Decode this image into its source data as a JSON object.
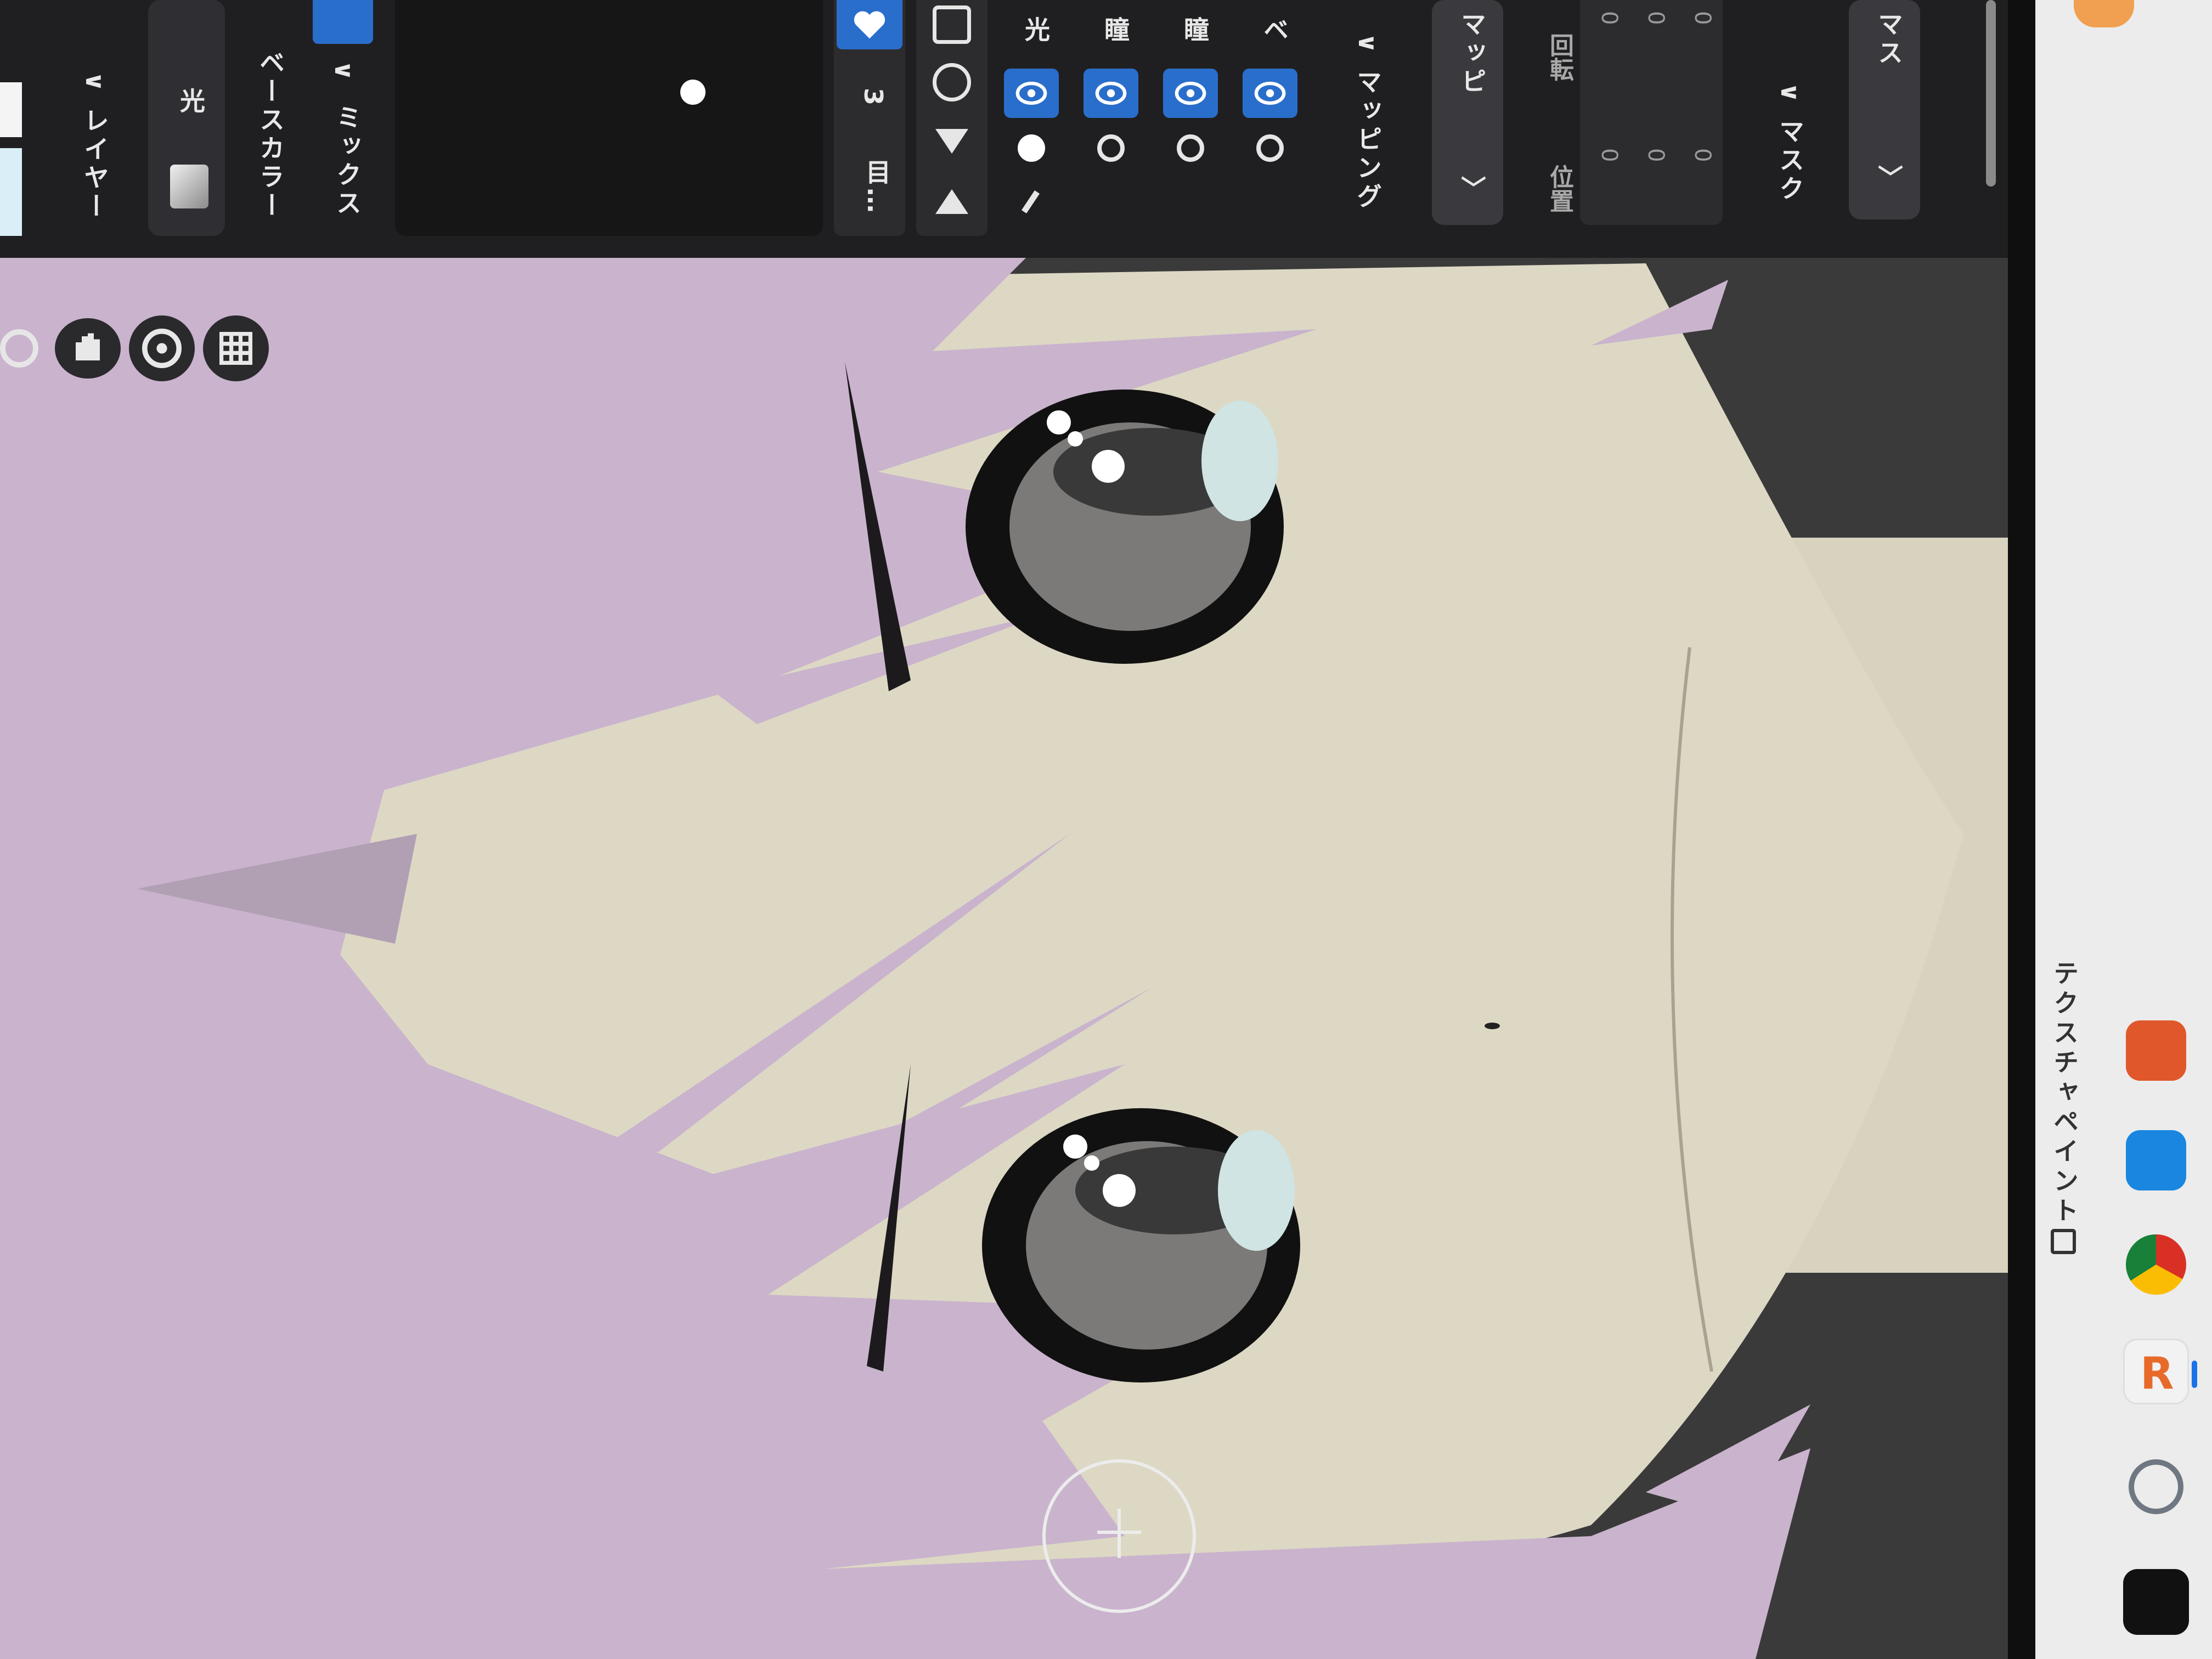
{
  "panel": {
    "layers_header": "レイヤー",
    "active_layer_label": "光",
    "base_color_label": "ベースカラー",
    "mix_label": "ミックス",
    "mix_value": "3",
    "layer_rows": [
      {
        "label": "光",
        "radio": "filled"
      },
      {
        "label": "瞳",
        "radio": "empty"
      },
      {
        "label": "瞳",
        "radio": "empty"
      },
      {
        "label": "ベ",
        "radio": "empty"
      }
    ],
    "list_truncated": "目…",
    "mapping_header": "マッピング",
    "mapping_button": "マッピ",
    "position_label": "位置",
    "rotation_label": "回転",
    "position_values": [
      "0",
      "0",
      "0"
    ],
    "rotation_values": [
      "0",
      "0",
      "0"
    ],
    "mask_header": "マスク",
    "mask_button": "マス"
  },
  "taskbar": {
    "app_label": "テクスチャペイント"
  },
  "colors": {
    "panel_bg": "#1f1f21",
    "accent_blue": "#2a6ecb",
    "hair": "#c9b3cd",
    "skin": "#ddd8c4",
    "viewport_bg": "#3a3939"
  },
  "icons": [
    "zoom-icon",
    "hand-pan-icon",
    "orbit-icon",
    "grid-icon",
    "eye-icon",
    "brush-icon",
    "lock-icon",
    "triangle-icon",
    "brush-cursor-icon"
  ]
}
